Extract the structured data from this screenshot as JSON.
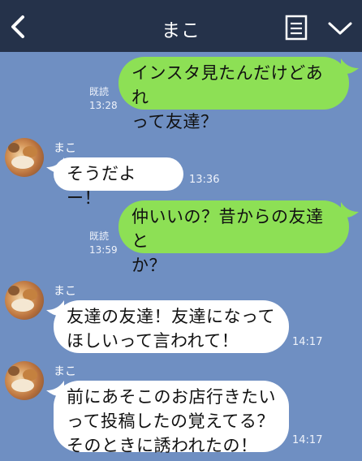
{
  "header": {
    "title": "まこ",
    "icons": [
      "back-chevron-icon",
      "note-list-icon",
      "chevron-down-icon"
    ]
  },
  "colors": {
    "header_bg": "#25324a",
    "chat_bg": "#6f8fc2",
    "outgoing_bubble": "#8de055",
    "incoming_bubble": "#ffffff"
  },
  "messages": [
    {
      "direction": "out",
      "lines": [
        "インスタ見たんだけどあれ",
        "って友達？"
      ],
      "read": "既読",
      "time": "13:28"
    },
    {
      "direction": "in",
      "sender": "まこ",
      "lines": [
        "そうだよー！"
      ],
      "time": "13:36"
    },
    {
      "direction": "out",
      "lines": [
        "仲いいの？昔からの友達と",
        "か？"
      ],
      "read": "既読",
      "time": "13:59"
    },
    {
      "direction": "in",
      "sender": "まこ",
      "lines": [
        "友達の友達！友達になって",
        "ほしいって言われて！"
      ],
      "time": "14:17"
    },
    {
      "direction": "in",
      "sender": "まこ",
      "lines": [
        "前にあそこのお店行きたい",
        "って投稿したの覚えてる？",
        "そのときに誘われたの！"
      ],
      "time": "14:17"
    }
  ]
}
